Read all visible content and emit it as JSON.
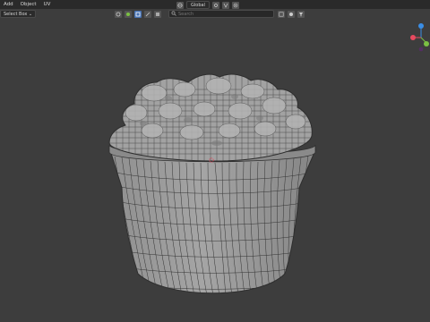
{
  "menu": [
    "Add",
    "Object",
    "UV"
  ],
  "select_mode": "Select Box",
  "orientation": "Global",
  "search": {
    "placeholder": "Search"
  },
  "colors": {
    "background": "#3d3d3d",
    "menubar": "#2a2a2a",
    "mesh_fill": "#9a9a9a",
    "wire": "#2e2e2e",
    "accent": "#4772b3",
    "axis_x": "#e84a5f",
    "axis_y": "#7bc043",
    "axis_z": "#3a8ee6"
  },
  "icons": [
    "select-mode-icon",
    "view-icon",
    "global-orientation-icon",
    "snap-icon",
    "proportional-edit-icon",
    "search-icon",
    "overlay-icon",
    "filter-icon",
    "navigation-gizmo-icon"
  ]
}
